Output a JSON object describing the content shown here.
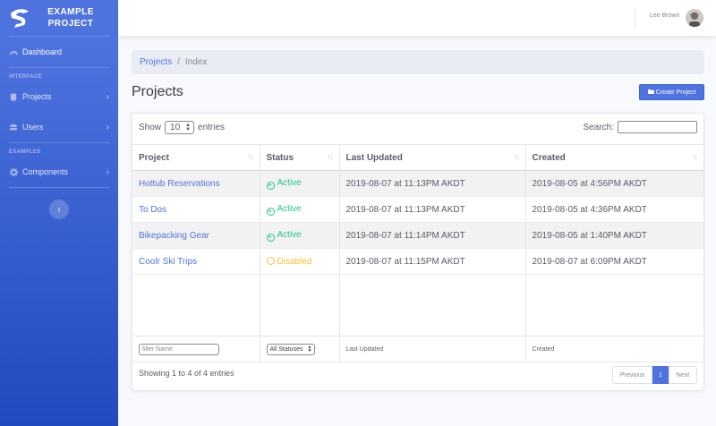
{
  "brand": {
    "line1": "EXAMPLE",
    "line2": "PROJECT"
  },
  "sidebar": {
    "dashboard": "Dashboard",
    "heading_interface": "INTERFACE",
    "projects": "Projects",
    "users": "Users",
    "heading_examples": "EXAMPLES",
    "components": "Components",
    "toggle_icon": "‹"
  },
  "topbar": {
    "user_name": "Lee Brown"
  },
  "breadcrumb": {
    "parent": "Projects",
    "separator": "/",
    "current": "Index"
  },
  "page": {
    "title": "Projects",
    "create_button": "Create Project"
  },
  "table_controls": {
    "show_label": "Show",
    "length_value": "10",
    "entries_label": "entries",
    "search_label": "Search:"
  },
  "table": {
    "headers": [
      "Project",
      "Status",
      "Last Updated",
      "Created"
    ],
    "rows": [
      {
        "project": "Hottub Reservations",
        "status": "Active",
        "status_type": "active",
        "last_updated": "2019-08-07 at 11:13PM AKDT",
        "created": "2019-08-05 at 4:56PM AKDT"
      },
      {
        "project": "To Dos",
        "status": "Active",
        "status_type": "active",
        "last_updated": "2019-08-07 at 11:13PM AKDT",
        "created": "2019-08-05 at 4:36PM AKDT"
      },
      {
        "project": "Bikepacking Gear",
        "status": "Active",
        "status_type": "active",
        "last_updated": "2019-08-07 at 11:14PM AKDT",
        "created": "2019-08-05 at 1:40PM AKDT"
      },
      {
        "project": "Coolr Ski Trips",
        "status": "Disabled",
        "status_type": "disabled",
        "last_updated": "2019-08-07 at 11:15PM AKDT",
        "created": "2019-08-07 at 6:09PM AKDT"
      }
    ],
    "filters": {
      "name_placeholder": "filter Name",
      "status_value": "All Statuses",
      "last_updated": "Last Updated",
      "created": "Created"
    }
  },
  "footer": {
    "info": "Showing 1 to 4 of 4 entries",
    "previous": "Previous",
    "page": "1",
    "next": "Next"
  },
  "colors": {
    "primary": "#4e73df",
    "active": "#1cc88a",
    "disabled": "#f6c23e"
  }
}
